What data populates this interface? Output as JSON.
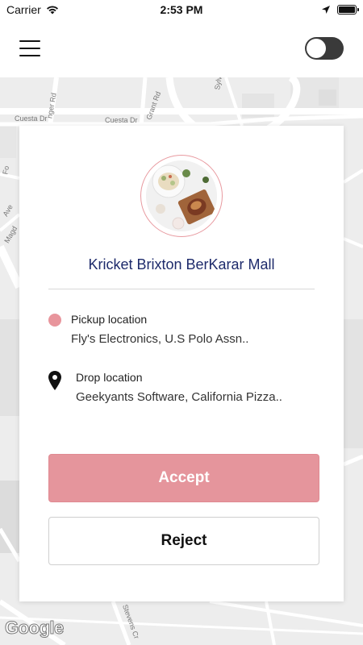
{
  "status_bar": {
    "carrier": "Carrier",
    "time": "2:53 PM",
    "battery_level": 1.0
  },
  "header": {
    "menu_icon": "hamburger-menu-icon",
    "toggle_state": "off"
  },
  "map": {
    "labels": [
      "Cuesta Dr",
      "Cuesta Dr",
      "Grant Rd",
      "nger Rd",
      "Sylv",
      "Fo",
      "Ave",
      "Magd",
      "Stevens Cr"
    ],
    "attribution": "Google"
  },
  "card": {
    "restaurant_name": "Kricket Brixton BerKarar Mall",
    "pickup": {
      "icon": "pickup-dot-icon",
      "title": "Pickup location",
      "address": "Fly's Electronics, U.S Polo Assn.."
    },
    "drop": {
      "icon": "map-pin-icon",
      "title": "Drop location",
      "address": "Geekyants Software, California Pizza.."
    },
    "accept_label": "Accept",
    "reject_label": "Reject"
  },
  "colors": {
    "accent": "#e5959c",
    "title": "#1d2a6b",
    "map_bg": "#eeeeee"
  }
}
